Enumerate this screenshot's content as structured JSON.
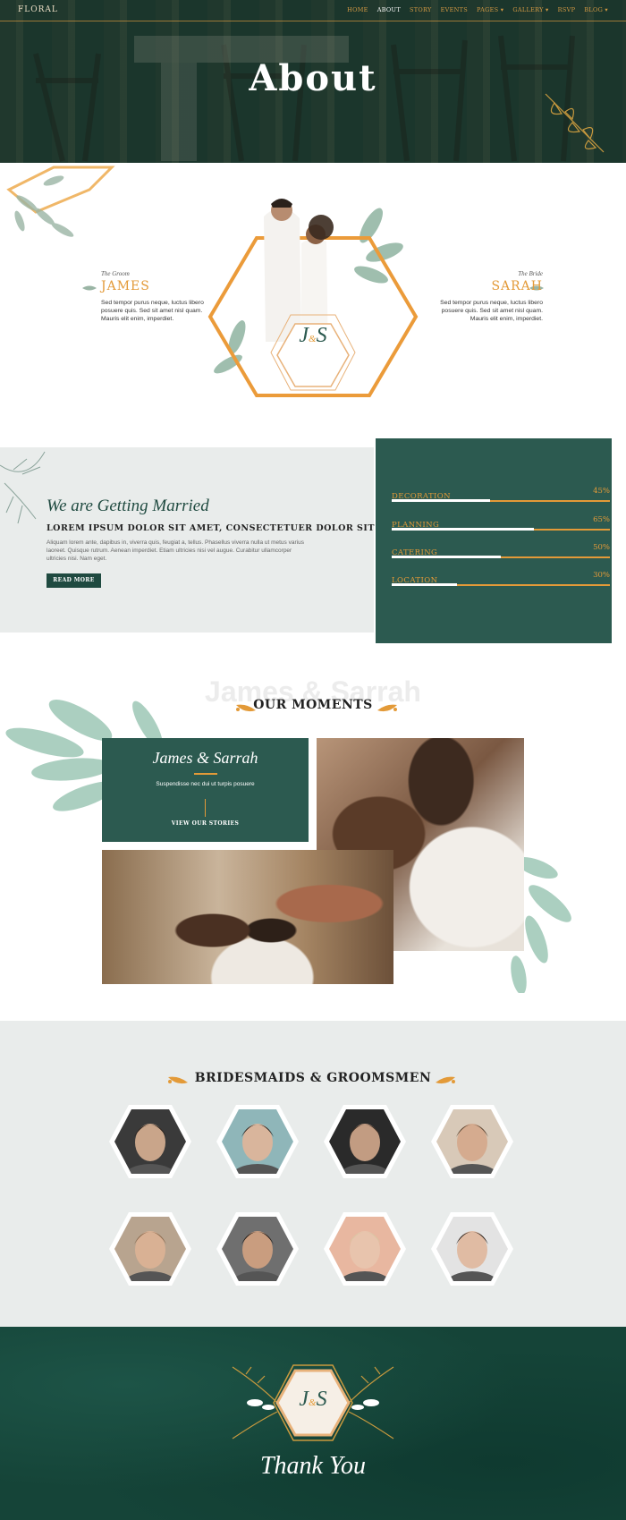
{
  "nav": {
    "brand": "FLORAL",
    "items": [
      {
        "label": "HOME"
      },
      {
        "label": "ABOUT"
      },
      {
        "label": "STORY"
      },
      {
        "label": "EVENTS"
      },
      {
        "label": "PAGES ▾"
      },
      {
        "label": "GALLERY ▾"
      },
      {
        "label": "RSVP"
      },
      {
        "label": "BLOG ▾"
      }
    ],
    "active": "ABOUT"
  },
  "hero": {
    "title": "About"
  },
  "couple": {
    "groom": {
      "role": "The Groom",
      "name": "JAMES",
      "bio": "Sed tempor purus neque, luctus libero posuere quis. Sed sit amet nisl quam. Mauris elit enim, imperdiet."
    },
    "bride": {
      "role": "The Bride",
      "name": "SARAH",
      "bio": "Sed tempor purus neque, luctus libero posuere quis. Sed sit amet nisl quam. Mauris elit enim, imperdiet."
    },
    "monogram": {
      "left": "J",
      "amp": "&",
      "right": "S"
    }
  },
  "married": {
    "script": "We are Getting Married",
    "heading": "LOREM IPSUM DOLOR SIT AMET, CONSECTETUER DOLOR SIT",
    "text": "Aliquam lorem ante, dapibus in, viverra quis, feugiat a, tellus. Phasellus viverra nulla ut metus varius laoreet. Quisque rutrum. Aenean imperdiet. Etiam ultricies nisi vel augue. Curabitur ullamcorper ultricies nisi. Nam eget.",
    "button": "READ MORE"
  },
  "skills": [
    {
      "label": "DECORATION",
      "percent_text": "45%",
      "value": 0.45
    },
    {
      "label": "PLANNING",
      "percent_text": "65%",
      "value": 0.65
    },
    {
      "label": "CATERING",
      "percent_text": "50%",
      "value": 0.5
    },
    {
      "label": "LOCATION",
      "percent_text": "30%",
      "value": 0.3
    }
  ],
  "moments": {
    "bg_text": "James & Sarrah",
    "title": "OUR MOMENTS",
    "card_title": "James & Sarrah",
    "card_text": "Suspendisse nec dui ut turpis posuere",
    "card_link": "VIEW OUR STORIES"
  },
  "bridesmaids": {
    "title": "BRIDESMAIDS & GROOMSMEN",
    "people": [
      {
        "name": "groomsman-1",
        "tone": "#c9a58a",
        "hair": "#2a211b",
        "bg": "#3a3a3a"
      },
      {
        "name": "groomsman-2",
        "tone": "#d9b59c",
        "hair": "#2c2520",
        "bg": "#8fb6b9"
      },
      {
        "name": "groomsman-3",
        "tone": "#c29c82",
        "hair": "#3a2d23",
        "bg": "#2a2a2a"
      },
      {
        "name": "groomsman-4",
        "tone": "#d5ab8f",
        "hair": "#5a4633",
        "bg": "#d8c9b8"
      },
      {
        "name": "bridesmaid-1",
        "tone": "#d9b194",
        "hair": "#8a6a4e",
        "bg": "#b8a48f"
      },
      {
        "name": "bridesmaid-2",
        "tone": "#c99d7f",
        "hair": "#241c17",
        "bg": "#6f6f6f"
      },
      {
        "name": "bridesmaid-3",
        "tone": "#e8c4ad",
        "hair": "#d9c6a2",
        "bg": "#e8b7a0"
      },
      {
        "name": "bridesmaid-4",
        "tone": "#e0bba3",
        "hair": "#2a201a",
        "bg": "#e3e3e3"
      }
    ]
  },
  "footer": {
    "script": "Thank You",
    "monogram": {
      "left": "J",
      "amp": "&",
      "right": "S"
    }
  },
  "colors": {
    "primary": "#2c5a50",
    "accent": "#e39a38",
    "light": "#e9eceb"
  }
}
